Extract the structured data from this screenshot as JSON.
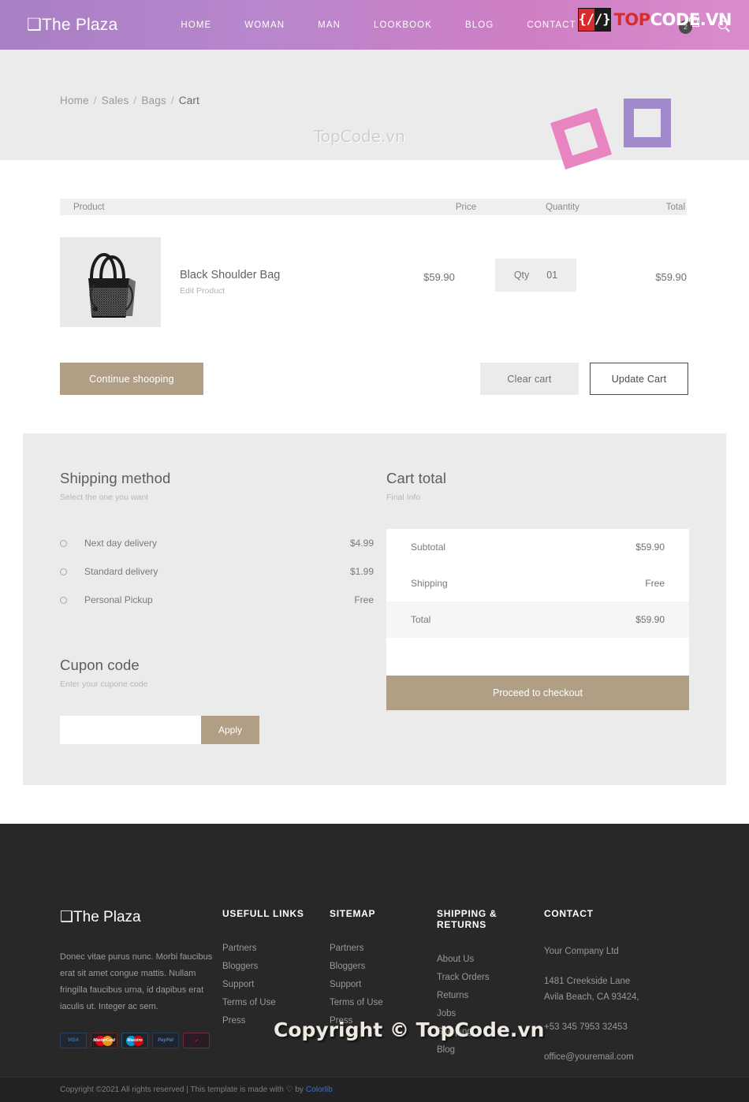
{
  "header": {
    "brand": "❑The Plaza",
    "nav": [
      {
        "label": "HOME"
      },
      {
        "label": "WOMAN"
      },
      {
        "label": "MAN"
      },
      {
        "label": "LOOKBOOK"
      },
      {
        "label": "BLOG"
      },
      {
        "label": "CONTACT"
      }
    ],
    "cart_count": "2",
    "accent_gradient_from": "#a87fc4",
    "accent_gradient_to": "#d98ccd"
  },
  "banner": {
    "breadcrumb": [
      {
        "label": "Home",
        "current": false
      },
      {
        "label": "Sales",
        "current": false
      },
      {
        "label": "Bags",
        "current": false
      },
      {
        "label": "Cart",
        "current": true
      }
    ],
    "separator": "/"
  },
  "cart_table": {
    "columns": {
      "product": "Product",
      "price": "Price",
      "quantity": "Quantity",
      "total": "Total"
    },
    "rows": [
      {
        "name": "Black Shoulder Bag",
        "edit_label": "Edit Product",
        "price": "$59.90",
        "qty_label": "Qty",
        "qty_value": "01",
        "total": "$59.90"
      }
    ]
  },
  "actions": {
    "continue": "Continue shooping",
    "clear": "Clear cart",
    "update": "Update Cart"
  },
  "shipping": {
    "title": "Shipping method",
    "subtitle": "Select the one you want",
    "options": [
      {
        "label": "Next day delivery",
        "price": "$4.99"
      },
      {
        "label": "Standard delivery",
        "price": "$1.99"
      },
      {
        "label": "Personal Pickup",
        "price": "Free"
      }
    ]
  },
  "coupon": {
    "title": "Cupon code",
    "subtitle": "Enter your cupone code",
    "value": "",
    "placeholder": "",
    "apply": "Apply"
  },
  "cart_total": {
    "title": "Cart total",
    "subtitle": "Final Info",
    "rows": [
      {
        "label": "Subtotal",
        "value": "$59.90"
      },
      {
        "label": "Shipping",
        "value": "Free"
      },
      {
        "label": "Total",
        "value": "$59.90"
      }
    ],
    "checkout": "Proceed to checkout",
    "accent": "#b09e85"
  },
  "footer": {
    "brand": "❑The Plaza",
    "description": "Donec vitae purus nunc. Morbi faucibus erat sit amet congue mattis. Nullam fringilla faucibus urna, id dapibus erat iaculis ut. Integer ac sem.",
    "payments": [
      {
        "name": "visa-card-icon",
        "label": "VISA"
      },
      {
        "name": "mastercard-icon",
        "label": "MasterCard"
      },
      {
        "name": "maestro-icon",
        "label": "Maestro"
      },
      {
        "name": "paypal-icon",
        "label": "PayPal"
      },
      {
        "name": "discover-icon",
        "label": "✔"
      }
    ],
    "columns": [
      {
        "heading": "USEFULL LINKS",
        "links": [
          "Partners",
          "Bloggers",
          "Support",
          "Terms of Use",
          "Press"
        ]
      },
      {
        "heading": "SITEMAP",
        "links": [
          "Partners",
          "Bloggers",
          "Support",
          "Terms of Use",
          "Press"
        ]
      },
      {
        "heading": "SHIPPING & RETURNS",
        "links": [
          "About Us",
          "Track Orders",
          "Returns",
          "Jobs",
          "Shipping",
          "Blog"
        ]
      }
    ],
    "contact": {
      "heading": "CONTACT",
      "company": "Your Company Ltd",
      "address_line1": "1481 Creekside Lane",
      "address_line2": "Avila Beach, CA 93424,",
      "phone": "+53 345 7953 32453",
      "email": "office@youremail.com"
    },
    "copyright_prefix": "Copyright ©2021 All rights reserved | This template is made with",
    "copyright_by": "by",
    "copyright_link": "Colorlib"
  },
  "watermarks": {
    "banner_text": "TopCode.vn",
    "footer_text": "Copyright © TopCode.vn",
    "logo_left": "{/",
    "logo_right": "/}",
    "logo_top": "TOP",
    "logo_code": "CODE",
    "logo_vn": ".VN"
  }
}
